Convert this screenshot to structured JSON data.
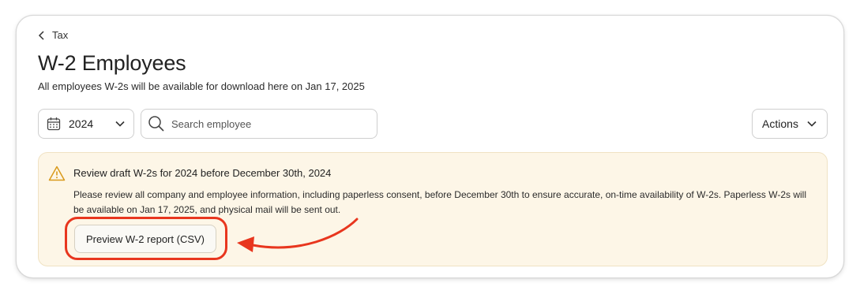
{
  "nav": {
    "back_label": "Tax"
  },
  "header": {
    "title": "W-2 Employees",
    "subtitle": "All employees W-2s will be available for download here on Jan 17, 2025"
  },
  "toolbar": {
    "year_value": "2024",
    "search_placeholder": "Search employee",
    "actions_label": "Actions"
  },
  "notice": {
    "title": "Review draft W-2s for 2024 before December 30th, 2024",
    "body": "Please review all company and employee information, including paperless consent, before December 30th to ensure accurate, on-time availability of W-2s. Paperless W-2s will be available on Jan 17, 2025, and physical mail will be sent out.",
    "button_label": "Preview W-2 report (CSV)"
  },
  "icons": {
    "back": "chevron-left-icon",
    "calendar": "calendar-icon",
    "dropdown": "chevron-down-icon",
    "search": "search-icon",
    "warning": "warning-triangle-icon",
    "annotation": "curved-arrow-icon"
  },
  "colors": {
    "notice_background": "#fdf6e7",
    "warning_icon": "#d99a1c",
    "annotation_red": "#e8361e"
  }
}
